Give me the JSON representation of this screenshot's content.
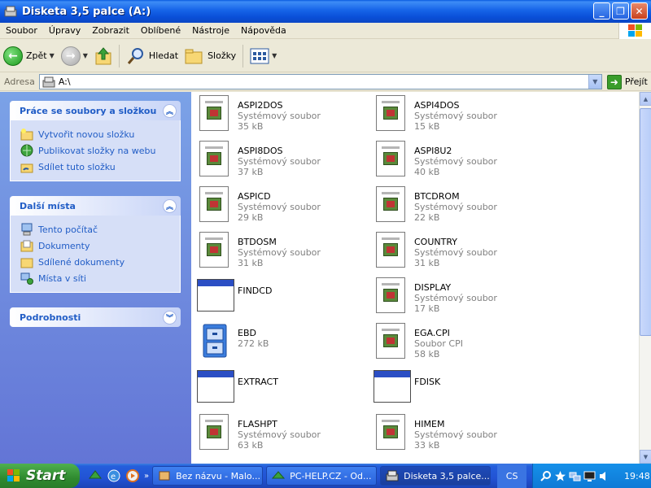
{
  "window": {
    "title": "Disketa 3,5 palce (A:)"
  },
  "menu": [
    "Soubor",
    "Úpravy",
    "Zobrazit",
    "Oblíbené",
    "Nástroje",
    "Nápověda"
  ],
  "toolbar": {
    "back": "Zpět",
    "search": "Hledat",
    "folders": "Složky"
  },
  "address": {
    "label": "Adresa",
    "value": "A:\\",
    "go": "Přejít"
  },
  "left_pane": {
    "tasks": {
      "title": "Práce se soubory a složkou",
      "items": [
        "Vytvořit novou složku",
        "Publikovat složky na webu",
        "Sdílet tuto složku"
      ]
    },
    "places": {
      "title": "Další místa",
      "items": [
        "Tento počítač",
        "Dokumenty",
        "Sdílené dokumenty",
        "Místa v síti"
      ]
    },
    "details": {
      "title": "Podrobnosti"
    }
  },
  "files": [
    {
      "name": "ASPI2DOS",
      "type": "Systémový soubor",
      "size": "35 kB",
      "icon": "sys"
    },
    {
      "name": "ASPI4DOS",
      "type": "Systémový soubor",
      "size": "15 kB",
      "icon": "sys"
    },
    {
      "name": "ASPI8DOS",
      "type": "Systémový soubor",
      "size": "37 kB",
      "icon": "sys"
    },
    {
      "name": "ASPI8U2",
      "type": "Systémový soubor",
      "size": "40 kB",
      "icon": "sys"
    },
    {
      "name": "ASPICD",
      "type": "Systémový soubor",
      "size": "29 kB",
      "icon": "sys"
    },
    {
      "name": "BTCDROM",
      "type": "Systémový soubor",
      "size": "22 kB",
      "icon": "sys"
    },
    {
      "name": "BTDOSM",
      "type": "Systémový soubor",
      "size": "31 kB",
      "icon": "sys"
    },
    {
      "name": "COUNTRY",
      "type": "Systémový soubor",
      "size": "31 kB",
      "icon": "sys"
    },
    {
      "name": "FINDCD",
      "type": "",
      "size": "",
      "icon": "app"
    },
    {
      "name": "DISPLAY",
      "type": "Systémový soubor",
      "size": "17 kB",
      "icon": "sys"
    },
    {
      "name": "EBD",
      "type": "272 kB",
      "size": "",
      "icon": "cabinet"
    },
    {
      "name": "EGA.CPI",
      "type": "Soubor CPI",
      "size": "58 kB",
      "icon": "sys"
    },
    {
      "name": "EXTRACT",
      "type": "",
      "size": "",
      "icon": "app"
    },
    {
      "name": "FDISK",
      "type": "",
      "size": "",
      "icon": "app"
    },
    {
      "name": "FLASHPT",
      "type": "Systémový soubor",
      "size": "63 kB",
      "icon": "sys"
    },
    {
      "name": "HIMEM",
      "type": "Systémový soubor",
      "size": "33 kB",
      "icon": "sys"
    }
  ],
  "taskbar": {
    "start": "Start",
    "tasks": [
      "Bez názvu - Malo...",
      "PC-HELP.CZ - Od...",
      "Disketa 3,5 palce..."
    ],
    "lang": "CS",
    "clock": "19:48"
  },
  "colors": {
    "title_blue": "#0a5be0",
    "pane_blue": "#6375d6",
    "link_blue": "#215dc6",
    "taskbar_blue": "#245edc",
    "start_green": "#2f8a2f"
  }
}
